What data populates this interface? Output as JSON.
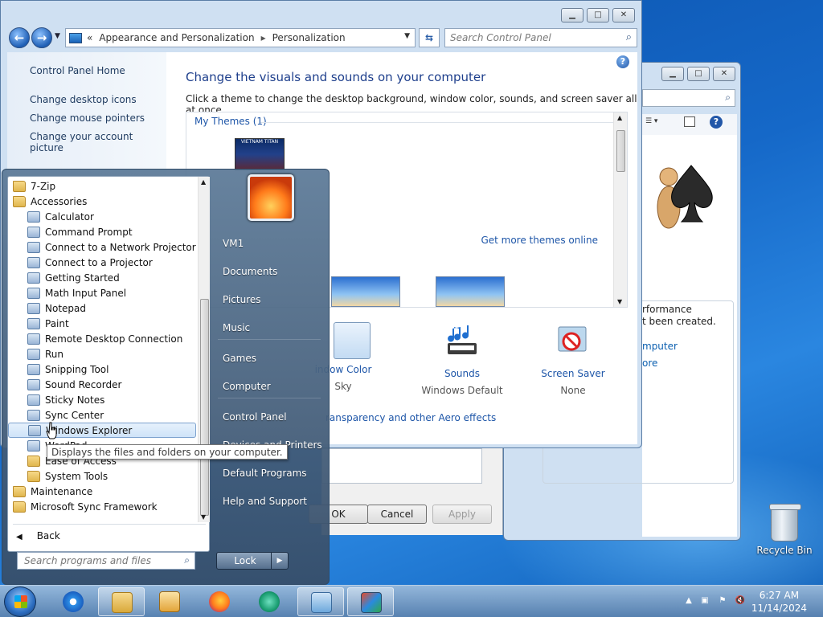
{
  "desktop": {
    "recycle_bin_label": "Recycle Bin"
  },
  "back_window": {
    "perf_text_1": "rformance",
    "perf_text_2": "t been created.",
    "link_1": "mputer",
    "link_2": "ore"
  },
  "main_window": {
    "breadcrumb": [
      "Appearance and Personalization",
      "Personalization"
    ],
    "breadcrumb_prefix": "«",
    "search_placeholder": "Search Control Panel",
    "left_links": {
      "home": "Control Panel Home",
      "desktop_icons": "Change desktop icons",
      "mouse_pointers": "Change mouse pointers",
      "account_picture": "Change your account picture"
    },
    "heading": "Change the visuals and sounds on your computer",
    "subheading": "Click a theme to change the desktop background, window color, sounds, and screen saver all at once.",
    "my_themes": "My Themes (1)",
    "theme_thumb_text": "VIETNAM TITAN",
    "get_more_themes": "Get more themes online",
    "bottom_items": [
      {
        "title": "indow Color",
        "value": "Sky"
      },
      {
        "title": "Sounds",
        "value": "Windows Default"
      },
      {
        "title": "Screen Saver",
        "value": "None"
      }
    ],
    "aero_link": "ransparency and other Aero effects"
  },
  "dialog_buttons": {
    "ok": "OK",
    "cancel": "Cancel",
    "apply": "Apply"
  },
  "start_menu": {
    "programs": [
      {
        "label": "7-Zip",
        "type": "folder",
        "indent": 0
      },
      {
        "label": "Accessories",
        "type": "folder",
        "indent": 0
      },
      {
        "label": "Calculator",
        "type": "app",
        "indent": 1
      },
      {
        "label": "Command Prompt",
        "type": "app",
        "indent": 1
      },
      {
        "label": "Connect to a Network Projector",
        "type": "app",
        "indent": 1
      },
      {
        "label": "Connect to a Projector",
        "type": "app",
        "indent": 1
      },
      {
        "label": "Getting Started",
        "type": "app",
        "indent": 1
      },
      {
        "label": "Math Input Panel",
        "type": "app",
        "indent": 1
      },
      {
        "label": "Notepad",
        "type": "app",
        "indent": 1
      },
      {
        "label": "Paint",
        "type": "app",
        "indent": 1
      },
      {
        "label": "Remote Desktop Connection",
        "type": "app",
        "indent": 1
      },
      {
        "label": "Run",
        "type": "app",
        "indent": 1
      },
      {
        "label": "Snipping Tool",
        "type": "app",
        "indent": 1
      },
      {
        "label": "Sound Recorder",
        "type": "app",
        "indent": 1
      },
      {
        "label": "Sticky Notes",
        "type": "app",
        "indent": 1
      },
      {
        "label": "Sync Center",
        "type": "app",
        "indent": 1
      },
      {
        "label": "Windows Explorer",
        "type": "app",
        "indent": 1,
        "highlighted": true
      },
      {
        "label": "WordPad",
        "type": "app",
        "indent": 1
      },
      {
        "label": "Ease of Access",
        "type": "folder",
        "indent": 1
      },
      {
        "label": "System Tools",
        "type": "folder",
        "indent": 1
      },
      {
        "label": "Maintenance",
        "type": "folder",
        "indent": 0
      },
      {
        "label": "Microsoft Sync Framework",
        "type": "folder",
        "indent": 0
      }
    ],
    "back_label": "Back",
    "search_placeholder": "Search programs and files",
    "right_items": [
      "VM1",
      "Documents",
      "Pictures",
      "Music",
      "Games",
      "Computer",
      "Control Panel",
      "Devices and Printers",
      "Default Programs",
      "Help and Support"
    ],
    "lock_label": "Lock"
  },
  "tooltip": "Displays the files and folders on your computer.",
  "taskbar": {
    "time": "6:27 AM",
    "date": "11/14/2024"
  }
}
